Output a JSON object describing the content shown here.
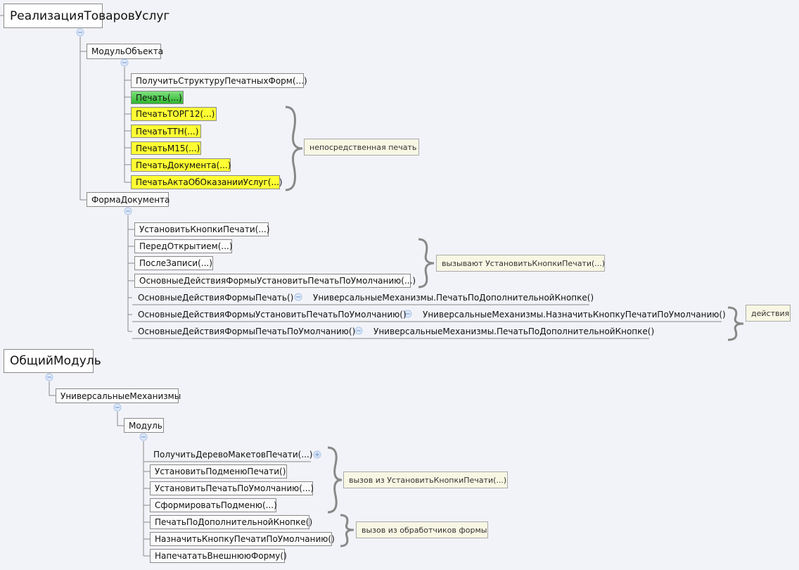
{
  "colors": {
    "background": "#f2f3f8",
    "green_node": "#3cbc3c",
    "yellow_node": "#ffff33",
    "note": "#f8f7e4",
    "line": "#8a8a8a",
    "collapse": "#a9c4ea"
  },
  "map1": {
    "root": "РеализацияТоваровУслуг",
    "module_object": "МодульОбъекта",
    "module_object_children": [
      "ПолучитьСтруктуруПечатныхФорм(...)",
      "Печать(...)",
      "ПечатьТОРГ12(...)",
      "ПечатьТТН(...)",
      "ПечатьМ15(...)",
      "ПечатьДокумента(...)",
      "ПечатьАктаОбОказанииУслуг(...)"
    ],
    "note_direct": "непосредственная печать",
    "form": "ФормаДокумента",
    "form_children": [
      "УстановитьКнопкиПечати(...)",
      "ПередОткрытием(...)",
      "ПослеЗаписи(...)",
      "ОсновныеДействияФормыУстановитьПечатьПоУмолчанию(...)"
    ],
    "note_calls": "вызывают УстановитьКнопкиПечати(...)",
    "actions": [
      {
        "handler": "ОсновныеДействияФормыПечать()",
        "target": "УниверсальныеМеханизмы.ПечатьПоДополнительнойКнопке()"
      },
      {
        "handler": "ОсновныеДействияФормыУстановитьПечатьПоУмолчанию()",
        "target": "УниверсальныеМеханизмы.НазначитьКнопкуПечатиПоУмолчанию()"
      },
      {
        "handler": "ОсновныеДействияФормыПечатьПоУмолчанию()",
        "target": "УниверсальныеМеханизмы.ПечатьПоДополнительнойКнопке()"
      }
    ],
    "note_actions": "действия"
  },
  "map2": {
    "root": "ОбщийМодуль",
    "um": "УниверсальныеМеханизмы",
    "module": "Модуль",
    "children": [
      "ПолучитьДеревоМакетовПечати(...)",
      "УстановитьПодменюПечати()",
      "УстановитьПечатьПоУмолчанию(...)",
      "СформироватьПодменю(...)",
      "ПечатьПоДополнительнойКнопке()",
      "НазначитьКнопкуПечатиПоУмолчанию()",
      "НапечататьВнешнююФорму()"
    ],
    "note_from_set": "вызов из УстановитьКнопкиПечати(...)",
    "note_from_handlers": "вызов из обработчиков формы"
  }
}
